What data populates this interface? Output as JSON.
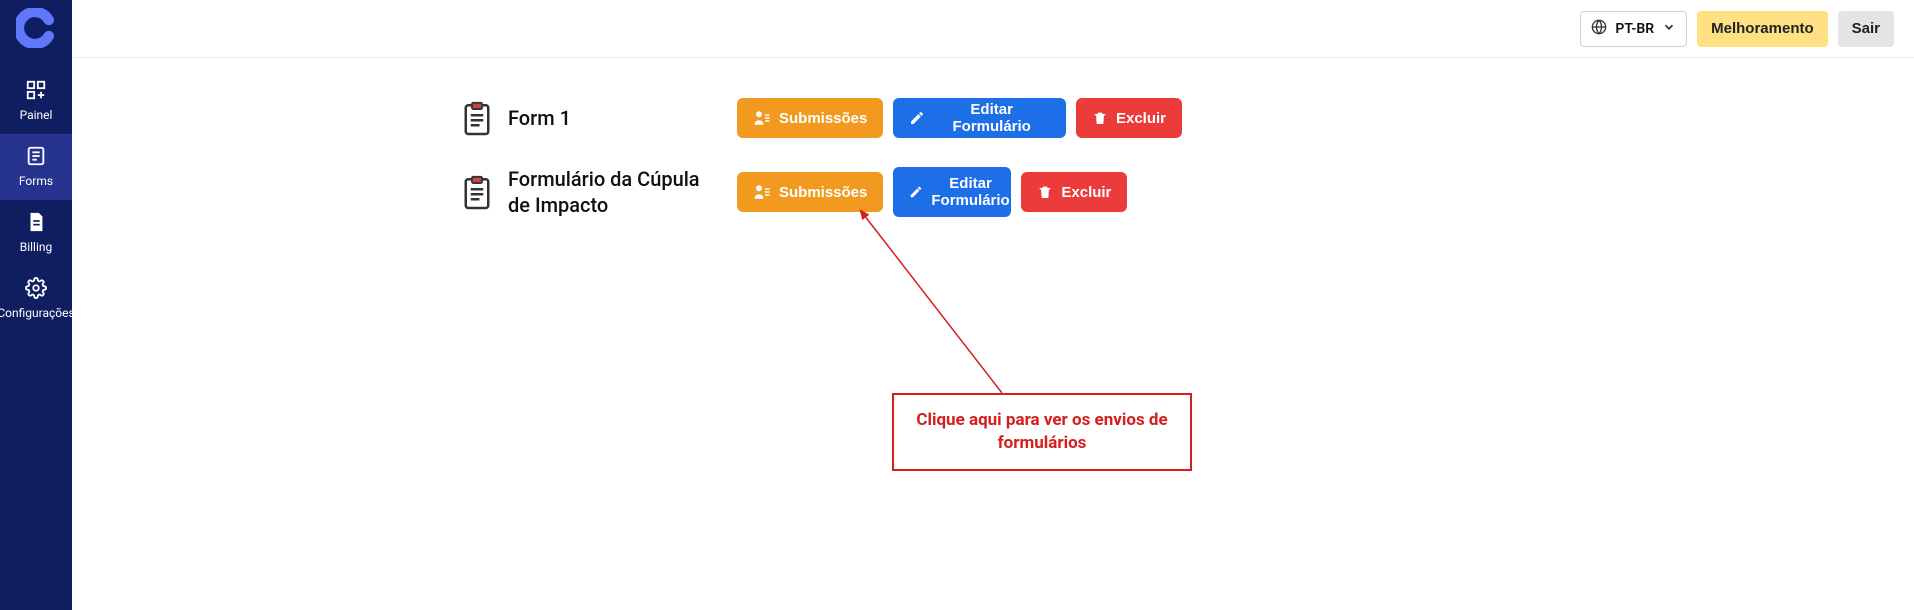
{
  "sidebar": {
    "items": [
      {
        "label": "Painel"
      },
      {
        "label": "Forms"
      },
      {
        "label": "Billing"
      },
      {
        "label": "Configurações"
      }
    ]
  },
  "header": {
    "language": "PT-BR",
    "upgrade": "Melhoramento",
    "logout": "Sair"
  },
  "forms": [
    {
      "name": "Form 1",
      "submissions": "Submissões",
      "edit": "Editar Formulário",
      "delete": "Excluir"
    },
    {
      "name": "Formulário da Cúpula de Impacto",
      "submissions": "Submissões",
      "edit": "Editar Formulário",
      "delete": "Excluir"
    }
  ],
  "callout": {
    "text": "Clique aqui para ver os envios de formulários"
  },
  "colors": {
    "sidebar_bg": "#0f1e61",
    "sidebar_active_bg": "#27348f",
    "logo": "#5f77f8",
    "btn_yellow": "#ffe183",
    "btn_gray": "#e4e4e4",
    "btn_orange": "#f29a1f",
    "btn_blue": "#1d6fe8",
    "btn_red": "#ec3b3b",
    "callout_red": "#d51e1e"
  }
}
